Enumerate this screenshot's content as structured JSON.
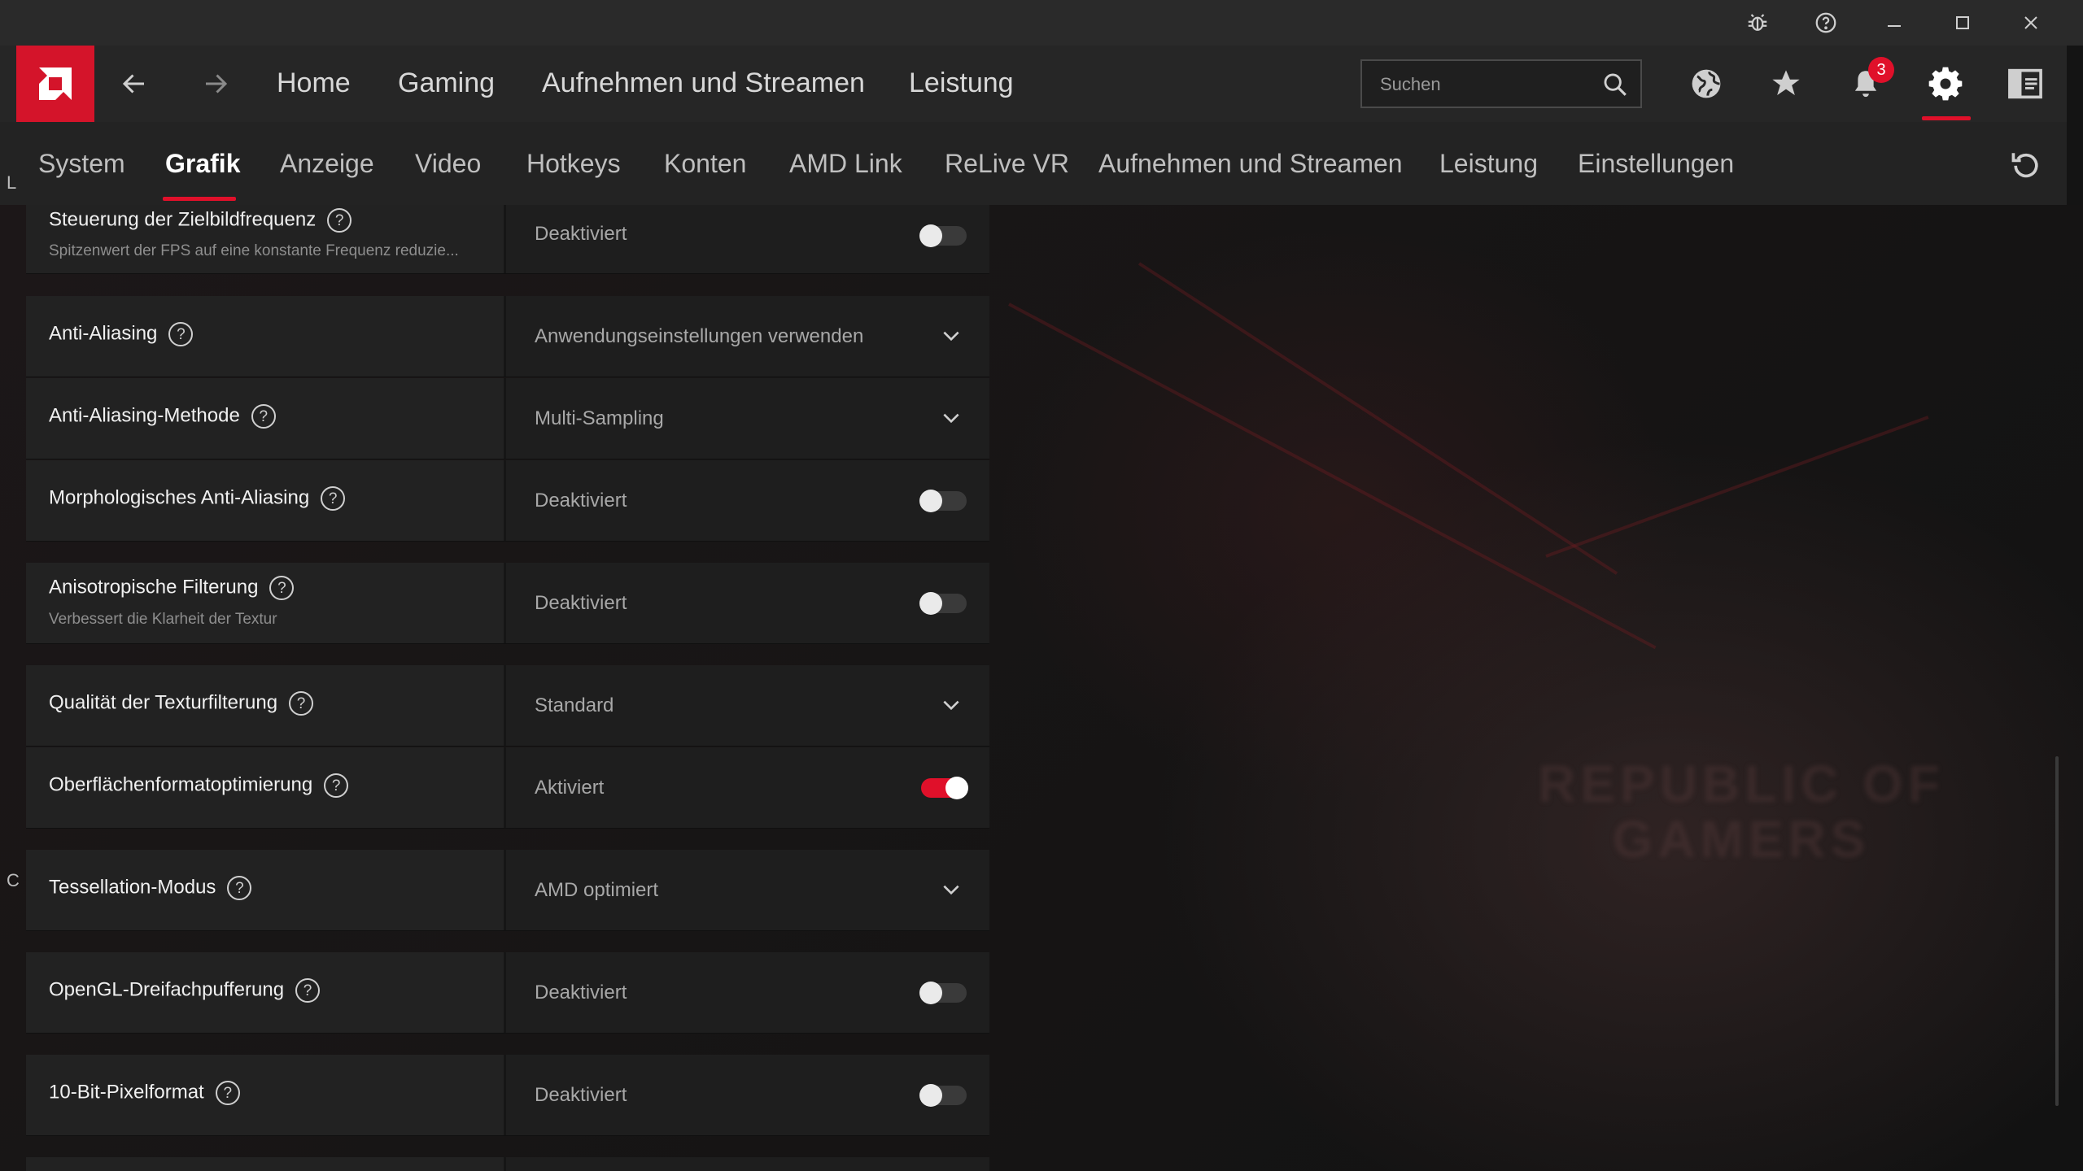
{
  "colors": {
    "accent": "#e0102a",
    "brand_red": "#d4142a",
    "background": "#141414"
  },
  "titlebar": {
    "icons": [
      "bug-report-icon",
      "help-icon",
      "minimize-icon",
      "maximize-icon",
      "close-icon"
    ]
  },
  "topnav": {
    "back_icon": "arrow-left-icon",
    "forward_icon": "arrow-right-icon",
    "links": [
      "Home",
      "Gaming",
      "Aufnehmen und Streamen",
      "Leistung"
    ],
    "search_placeholder": "Suchen",
    "notification_count": "3",
    "right_icons": [
      "globe-icon",
      "star-icon",
      "bell-icon",
      "gear-icon",
      "sidebar-panel-icon"
    ]
  },
  "subnav": {
    "tabs": [
      "System",
      "Grafik",
      "Anzeige",
      "Video",
      "Hotkeys",
      "Konten",
      "AMD Link",
      "ReLive VR",
      "Aufnehmen und Streamen",
      "Leistung",
      "Einstellungen"
    ],
    "active_tab": "Grafik",
    "reset_icon": "reset-icon"
  },
  "edge_letters": [
    "L",
    "C"
  ],
  "background_text": [
    "REPUBLIC OF",
    "GAMERS"
  ],
  "settings": [
    {
      "label": "Steuerung der Zielbildfrequenz",
      "description": "Spitzenwert der FPS auf eine konstante Frequenz reduzie...",
      "value": "Deaktiviert",
      "control": "toggle",
      "on": false
    },
    {
      "label": "Anti-Aliasing",
      "description": "",
      "value": "Anwendungseinstellungen verwenden",
      "control": "dropdown",
      "on": false
    },
    {
      "label": "Anti-Aliasing-Methode",
      "description": "",
      "value": "Multi-Sampling",
      "control": "dropdown",
      "on": false
    },
    {
      "label": "Morphologisches Anti-Aliasing",
      "description": "",
      "value": "Deaktiviert",
      "control": "toggle",
      "on": false
    },
    {
      "label": "Anisotropische Filterung",
      "description": "Verbessert die Klarheit der Textur",
      "value": "Deaktiviert",
      "control": "toggle",
      "on": false
    },
    {
      "label": "Qualität der Texturfilterung",
      "description": "",
      "value": "Standard",
      "control": "dropdown",
      "on": false
    },
    {
      "label": "Oberflächenformatoptimierung",
      "description": "",
      "value": "Aktiviert",
      "control": "toggle",
      "on": true
    },
    {
      "label": "Tessellation-Modus",
      "description": "",
      "value": "AMD optimiert",
      "control": "dropdown",
      "on": false
    },
    {
      "label": "OpenGL-Dreifachpufferung",
      "description": "",
      "value": "Deaktiviert",
      "control": "toggle",
      "on": false
    },
    {
      "label": "10-Bit-Pixelformat",
      "description": "",
      "value": "Deaktiviert",
      "control": "toggle",
      "on": false
    }
  ]
}
